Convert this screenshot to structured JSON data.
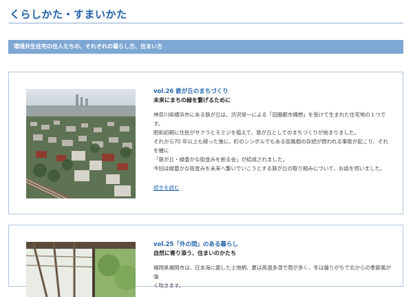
{
  "header": {
    "title": "くらしかた・すまいかた",
    "section_heading": "環境共生住宅の住人たちの、それぞれの暮らし方、住まい方"
  },
  "articles": [
    {
      "vol": "vol.26 鉄が丘のまちづくり",
      "subtitle": "未来にまちの緑を繋げるために",
      "paragraphs": [
        "神奈川県横浜市にある鉄が丘は、渋沢栄一による「田園都市構想」を受けて生まれた住宅地の１つです。",
        "昭和初期に住民がサクラとモミジを植えて、鉄が丘としてのまちづくりが始まりました。",
        "それから70 年以上も経った後に、町のシンボルでもある街路樹の存続が問われる事態が起こり、それを機に",
        "「鉄が丘・緑豊かな街並みを創る会」が結成されました。",
        "今回は緑豊かな街並みを未来へ繋いでいこうとする鉄が丘の取り組みについて、お話を伺いました。"
      ],
      "read_more": "続きを読む"
    },
    {
      "vol": "vol.25「外の間」のある暮らし",
      "subtitle": "自然に寄り添う、住まいのかたち",
      "paragraphs": [
        "福岡県福岡市は、日本海に面した土地柄、夏は高温多湿で雨が多く、冬は曇りがちで北からの季節風が強",
        "く吹きます。"
      ]
    }
  ]
}
